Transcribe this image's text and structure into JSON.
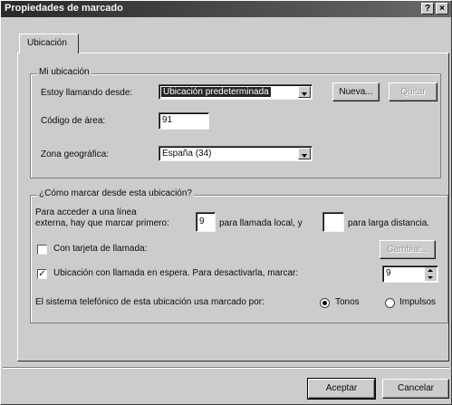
{
  "window": {
    "title": "Propiedades de marcado",
    "help_button": "?",
    "close_button": "×"
  },
  "tabs": [
    {
      "label": "Ubicación"
    }
  ],
  "my_location": {
    "legend": "Mi ubicación",
    "calling_from_label": "Estoy llamando desde:",
    "calling_from_value": "Ubicación predeterminada",
    "new_button": "Nueva...",
    "remove_button": "Quitar",
    "area_code_label": "Código de área:",
    "area_code_value": "91",
    "zone_label": "Zona geográfica:",
    "zone_value": "España (34)"
  },
  "how_to_dial": {
    "legend": "¿Cómo marcar desde esta ubicación?",
    "outside_line_label_1": "Para acceder a una línea",
    "outside_line_label_2": "externa, hay que marcar primero:",
    "local_prefix_value": "9",
    "local_label": "para llamada local, y",
    "long_distance_value": "",
    "long_distance_label": "para larga distancia.",
    "calling_card_label": "Con tarjeta de llamada:",
    "calling_card_checked": false,
    "change_button": "Cambiar...",
    "call_waiting_label": "Ubicación con llamada en espera. Para desactivarla, marcar:",
    "call_waiting_checked": true,
    "call_waiting_value": "9",
    "dial_mode_label": "El sistema telefónico de esta ubicación usa marcado por:",
    "tone_label": "Tonos",
    "pulse_label": "Impulsos",
    "selected_mode": "Tonos"
  },
  "footer": {
    "accept_button": "Aceptar",
    "cancel_button": "Cancelar"
  },
  "colors": {
    "face": "#c8c8c8",
    "titlebar": "#2d2d2d"
  }
}
